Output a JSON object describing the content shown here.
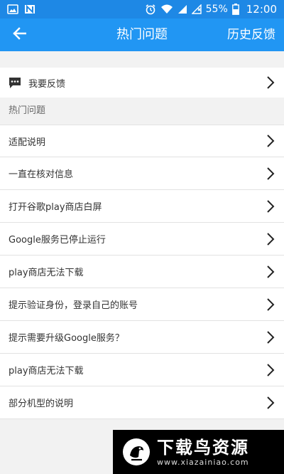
{
  "status_bar": {
    "left_icons": [
      "image-icon",
      "n-app-icon"
    ],
    "right_icons": [
      "alarm-icon",
      "wifi-icon",
      "signal-icon",
      "no-sim-icon",
      "battery-icon"
    ],
    "battery": "55%",
    "time": "12:00"
  },
  "header": {
    "back_icon": "arrow-left-icon",
    "title": "热门问题",
    "history_button": "历史反馈"
  },
  "feedback": {
    "icon": "chat-bubble-icon",
    "label": "我要反馈"
  },
  "section": {
    "title": "热门问题"
  },
  "faq": {
    "items": [
      {
        "label": "适配说明"
      },
      {
        "label": "一直在核对信息"
      },
      {
        "label": "打开谷歌play商店白屏"
      },
      {
        "label": "Google服务已停止运行"
      },
      {
        "label": "play商店无法下载"
      },
      {
        "label": "提示验证身份，登录自己的账号"
      },
      {
        "label": "提示需要升级Google服务？"
      },
      {
        "label": "play商店无法下载"
      },
      {
        "label": "部分机型的说明"
      }
    ]
  },
  "watermark": {
    "name": "下载鸟资源",
    "url": "www.xiazainiao.com"
  },
  "colors": {
    "status_bar": "#1e88e5",
    "title_bar": "#2196f3",
    "background": "#f2f2f2",
    "divider": "#e2e2e2"
  }
}
